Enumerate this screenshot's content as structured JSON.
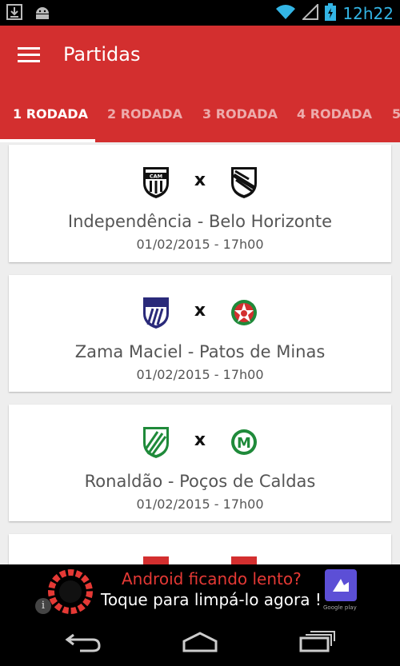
{
  "status_bar": {
    "time": "12h22",
    "left_icons": [
      "download-icon",
      "android-icon"
    ],
    "right_icons": [
      "wifi-icon",
      "signal-icon",
      "battery-charging-icon"
    ],
    "accent_color": "#33b5e5"
  },
  "app_bar": {
    "title": "Partidas",
    "menu_icon": "hamburger-menu-icon",
    "color": "#d32f2f"
  },
  "tabs": [
    {
      "label": "1 RODADA",
      "active": true
    },
    {
      "label": "2 RODADA",
      "active": false
    },
    {
      "label": "3 RODADA",
      "active": false
    },
    {
      "label": "4 RODADA",
      "active": false
    },
    {
      "label": "5",
      "active": false
    }
  ],
  "matches": [
    {
      "home_crest": "atletico-mineiro-crest",
      "away_crest": "tupi-crest",
      "versus": "x",
      "stadium": "Independência - Belo Horizonte",
      "datetime": "01/02/2015 - 17h00"
    },
    {
      "home_crest": "villa-nova-crest",
      "away_crest": "boa-esporte-crest",
      "versus": "x",
      "stadium": "Zama Maciel - Patos de Minas",
      "datetime": "01/02/2015 - 17h00"
    },
    {
      "home_crest": "caldense-crest",
      "away_crest": "mamore-crest",
      "versus": "x",
      "stadium": "Ronaldão - Poços de Caldas",
      "datetime": "01/02/2015 - 17h00"
    },
    {
      "home_crest": "partial-crest",
      "away_crest": "partial-crest",
      "versus": "",
      "stadium": "",
      "datetime": ""
    }
  ],
  "ad": {
    "line1": "Android ficando lento?",
    "line2": "Toque para limpá-lo agora !",
    "info_icon": "info-icon",
    "store_badge": "Google play"
  },
  "nav_bar": {
    "icons": [
      "back-icon",
      "home-icon",
      "recents-icon"
    ]
  }
}
